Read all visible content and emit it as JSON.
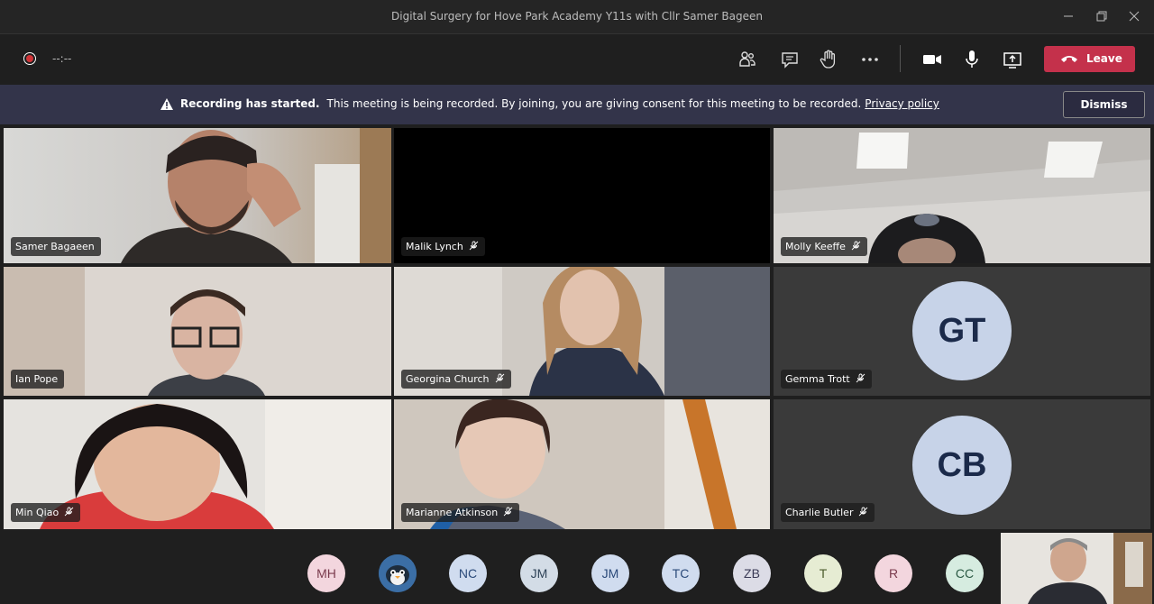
{
  "window": {
    "title": "Digital Surgery for Hove Park Academy Y11s with Cllr Samer Bageen",
    "controls": [
      "minimize-icon",
      "restore-icon",
      "close-icon"
    ]
  },
  "toolbar": {
    "timer": "--:--",
    "icons": [
      "participants-icon",
      "chat-icon",
      "raise-hand-icon",
      "more-options-icon",
      "camera-icon",
      "microphone-icon",
      "share-screen-icon"
    ],
    "leave_label": "Leave",
    "leave_color": "#c4314b"
  },
  "banner": {
    "title": "Recording has started.",
    "message": "This meeting is being recorded. By joining, you are giving consent for this meeting to be recorded.",
    "link": "Privacy policy",
    "dismiss_label": "Dismiss"
  },
  "participants": [
    {
      "name": "Samer Bagaeen",
      "muted": false,
      "video": true
    },
    {
      "name": "Malik Lynch",
      "muted": true,
      "video": false
    },
    {
      "name": "Molly Keeffe",
      "muted": true,
      "video": true
    },
    {
      "name": "Ian Pope",
      "muted": false,
      "video": true
    },
    {
      "name": "Georgina Church",
      "muted": true,
      "video": true
    },
    {
      "name": "Gemma Trott",
      "muted": true,
      "video": false,
      "initials": "GT"
    },
    {
      "name": "Min Qiao",
      "muted": true,
      "video": true
    },
    {
      "name": "Marianne Atkinson",
      "muted": true,
      "video": true
    },
    {
      "name": "Charlie Butler",
      "muted": true,
      "video": false,
      "initials": "CB"
    }
  ],
  "overflow_avatars": [
    {
      "initials": "MH",
      "bg": "#f3d6de",
      "fg": "#7a3b4d"
    },
    {
      "initials": "",
      "bg": "#3b6ea5",
      "fg": "#ffffff",
      "icon": "penguin-avatar-icon"
    },
    {
      "initials": "NC",
      "bg": "#d0dcef",
      "fg": "#2b4a7a"
    },
    {
      "initials": "JM",
      "bg": "#d3dce6",
      "fg": "#2f4358"
    },
    {
      "initials": "JM",
      "bg": "#d0dcef",
      "fg": "#2b4a7a"
    },
    {
      "initials": "TC",
      "bg": "#d0dcef",
      "fg": "#2b4a7a"
    },
    {
      "initials": "ZB",
      "bg": "#dcdce6",
      "fg": "#3a3a55"
    },
    {
      "initials": "T",
      "bg": "#e6ecd3",
      "fg": "#4a5a2b"
    },
    {
      "initials": "R",
      "bg": "#f3d6de",
      "fg": "#7a3b4d"
    },
    {
      "initials": "CC",
      "bg": "#d6ece0",
      "fg": "#2b5a44"
    }
  ]
}
